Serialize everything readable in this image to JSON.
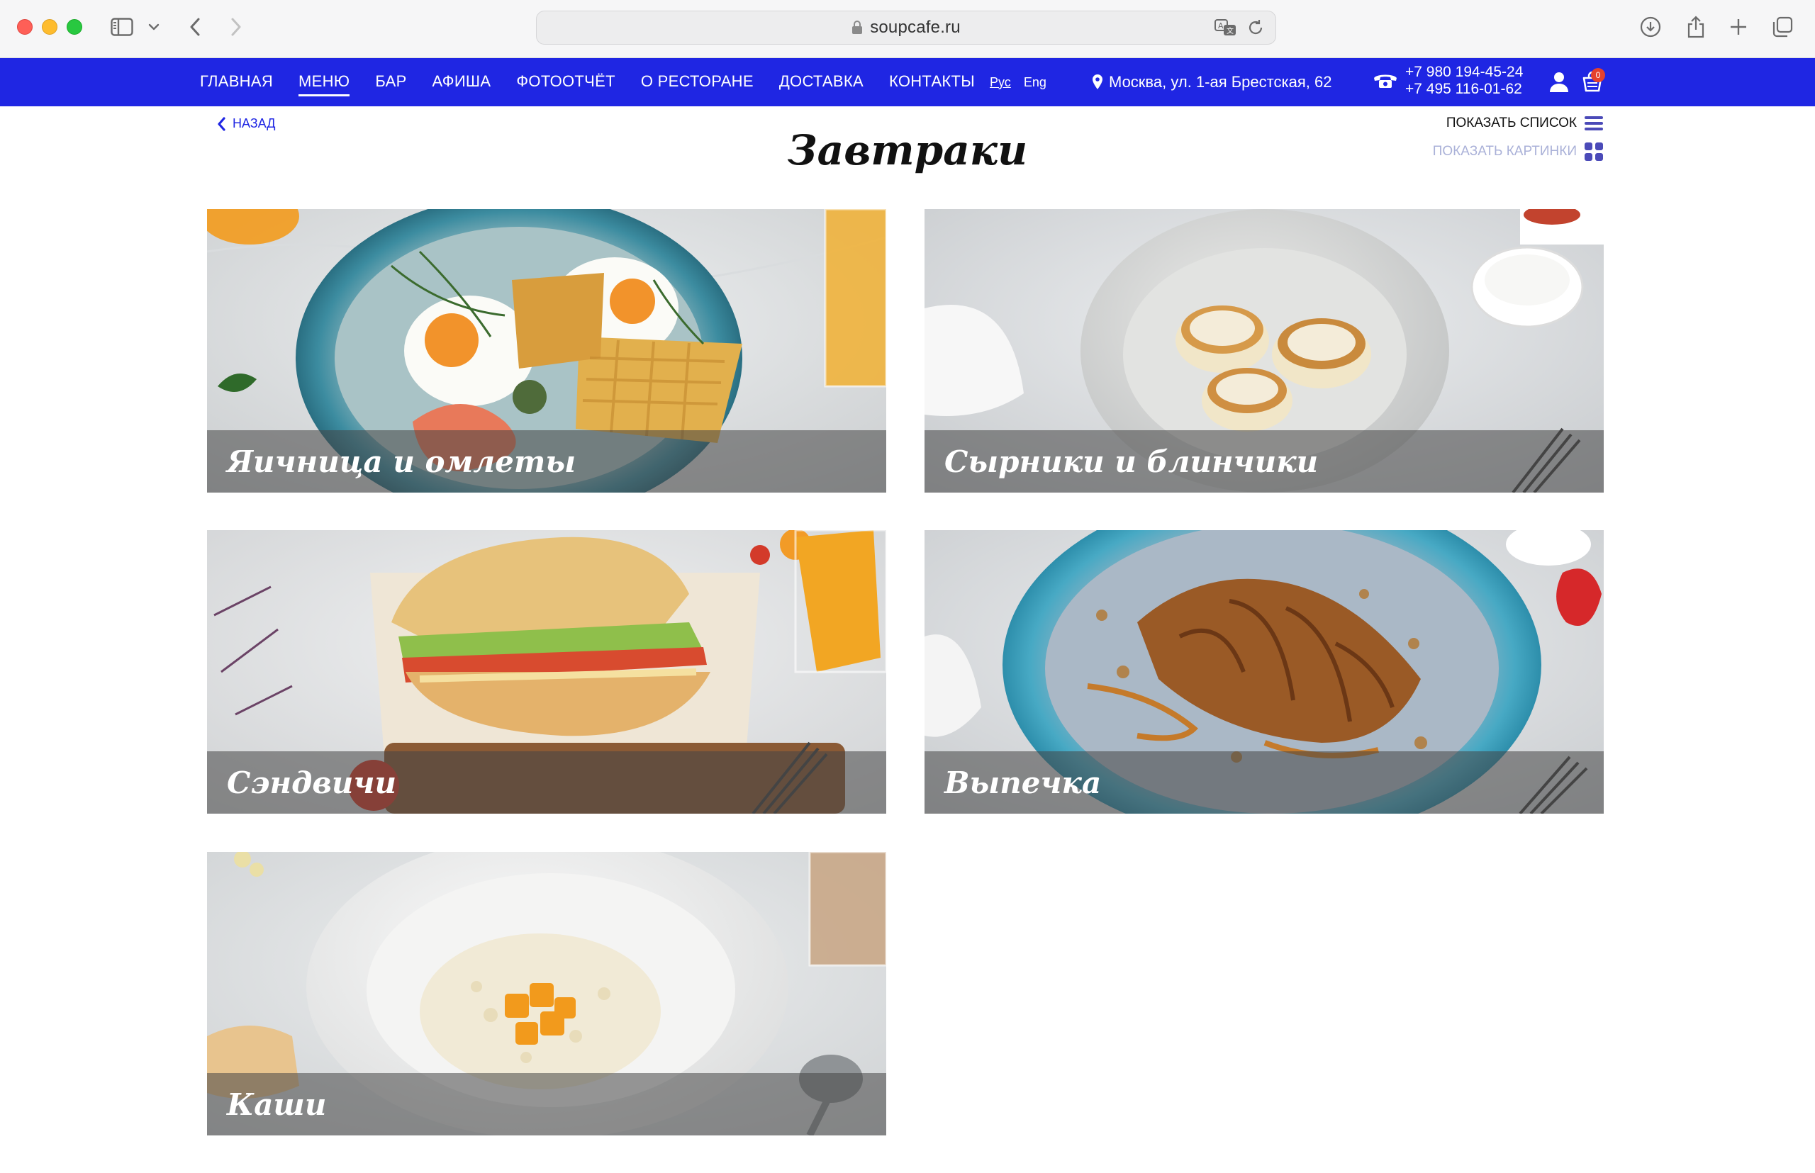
{
  "browser": {
    "url": "soupcafe.ru"
  },
  "nav": {
    "items": [
      "Главная",
      "Меню",
      "Бар",
      "Афиша",
      "Фотоотчёт",
      "О ресторане",
      "Доставка",
      "Контакты"
    ],
    "active_index": 1,
    "lang_ru": "Рус",
    "lang_en": "Eng",
    "address": "Москва, ул. 1-ая Брестская, 62",
    "phone1": "+7 980 194-45-24",
    "phone2": "+7 495 116-01-62",
    "cart_count": "0"
  },
  "page": {
    "back_label": "Назад",
    "title": "Завтраки",
    "show_list_label": "Показать список",
    "show_pictures_label": "Показать картинки"
  },
  "categories": [
    {
      "title": "Яичница и омлеты"
    },
    {
      "title": "Сырники и блинчики"
    },
    {
      "title": "Сэндвичи"
    },
    {
      "title": "Выпечка"
    },
    {
      "title": "Каши"
    }
  ],
  "colors": {
    "brand_blue": "#1f26e3",
    "cart_badge": "#e5412d"
  }
}
